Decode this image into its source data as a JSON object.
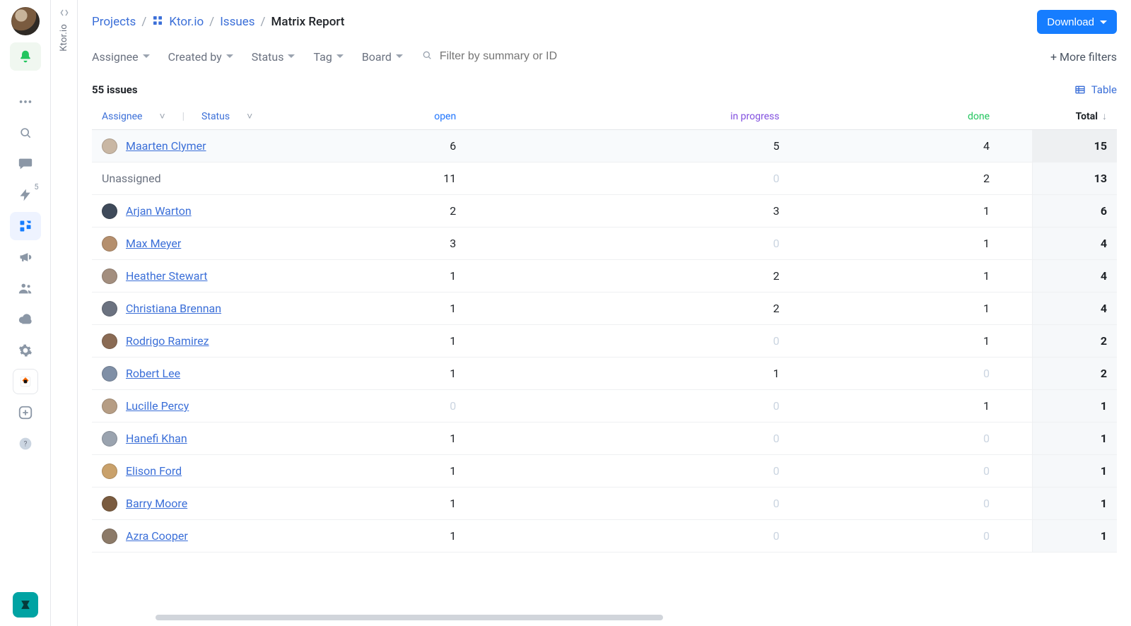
{
  "rail": {
    "badge_count": "5"
  },
  "tabstrip": {
    "label": "Ktor.io"
  },
  "breadcrumb": {
    "l0": "Projects",
    "l1": "Ktor.io",
    "l2": "Issues",
    "current": "Matrix Report"
  },
  "actions": {
    "download": "Download"
  },
  "filters": {
    "items": [
      "Assignee",
      "Created by",
      "Status",
      "Tag",
      "Board"
    ],
    "search_placeholder": "Filter by summary or ID",
    "more": "+ More filters"
  },
  "count_label": "55 issues",
  "view_toggle": "Table",
  "columns": {
    "group_primary": "Assignee",
    "group_secondary": "Status",
    "open": "open",
    "in_progress": "in progress",
    "done": "done",
    "total": "Total"
  },
  "rows": [
    {
      "name": "Maarten Clymer",
      "unassigned": false,
      "open": 6,
      "prog": 5,
      "done": 4,
      "total": 15
    },
    {
      "name": "Unassigned",
      "unassigned": true,
      "open": 11,
      "prog": 0,
      "done": 2,
      "total": 13
    },
    {
      "name": "Arjan Warton",
      "unassigned": false,
      "open": 2,
      "prog": 3,
      "done": 1,
      "total": 6
    },
    {
      "name": "Max Meyer",
      "unassigned": false,
      "open": 3,
      "prog": 0,
      "done": 1,
      "total": 4
    },
    {
      "name": "Heather Stewart",
      "unassigned": false,
      "open": 1,
      "prog": 2,
      "done": 1,
      "total": 4
    },
    {
      "name": "Christiana Brennan",
      "unassigned": false,
      "open": 1,
      "prog": 2,
      "done": 1,
      "total": 4
    },
    {
      "name": "Rodrigo Ramirez",
      "unassigned": false,
      "open": 1,
      "prog": 0,
      "done": 1,
      "total": 2
    },
    {
      "name": "Robert Lee",
      "unassigned": false,
      "open": 1,
      "prog": 1,
      "done": 0,
      "total": 2
    },
    {
      "name": "Lucille Percy",
      "unassigned": false,
      "open": 0,
      "prog": 0,
      "done": 1,
      "total": 1
    },
    {
      "name": "Hanefi Khan",
      "unassigned": false,
      "open": 1,
      "prog": 0,
      "done": 0,
      "total": 1
    },
    {
      "name": "Elison Ford",
      "unassigned": false,
      "open": 1,
      "prog": 0,
      "done": 0,
      "total": 1
    },
    {
      "name": "Barry Moore",
      "unassigned": false,
      "open": 1,
      "prog": 0,
      "done": 0,
      "total": 1
    },
    {
      "name": "Azra Cooper",
      "unassigned": false,
      "open": 1,
      "prog": 0,
      "done": 0,
      "total": 1
    }
  ]
}
